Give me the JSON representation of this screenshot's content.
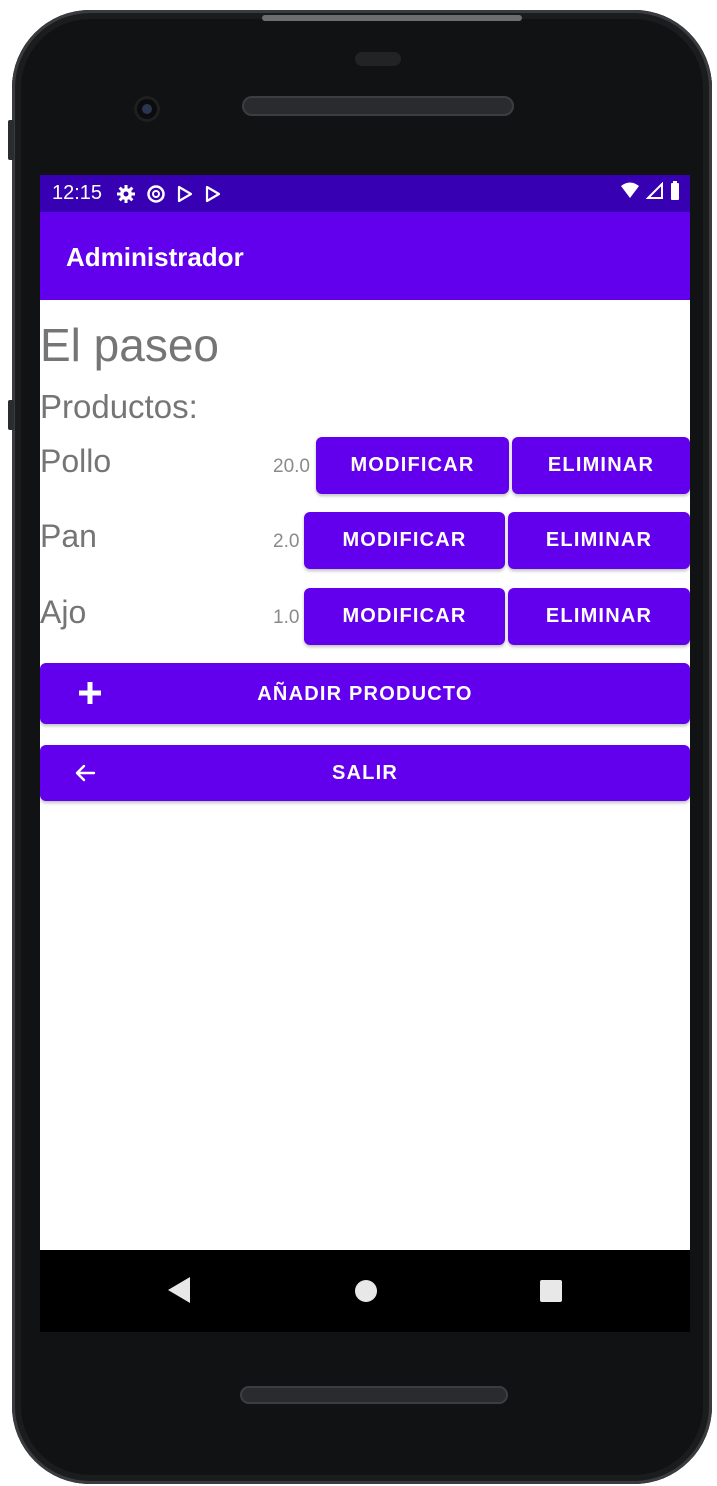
{
  "status_bar": {
    "time": "12:15"
  },
  "app_bar": {
    "title": "Administrador"
  },
  "store": {
    "name": "El paseo",
    "products_label": "Productos:"
  },
  "products": [
    {
      "name": "Pollo",
      "price": "20.0",
      "modify_label": "MODIFICAR",
      "delete_label": "ELIMINAR"
    },
    {
      "name": "Pan",
      "price": "2.0",
      "modify_label": "MODIFICAR",
      "delete_label": "ELIMINAR"
    },
    {
      "name": "Ajo",
      "price": "1.0",
      "modify_label": "MODIFICAR",
      "delete_label": "ELIMINAR"
    }
  ],
  "actions": {
    "add_product_label": "AÑADIR PRODUCTO",
    "exit_label": "SALIR"
  },
  "colors": {
    "primary": "#6200ee",
    "primary_dark": "#3700b3",
    "text_gray": "#757575"
  },
  "icons": {
    "add": "plus-icon",
    "exit": "arrow-left-icon"
  }
}
